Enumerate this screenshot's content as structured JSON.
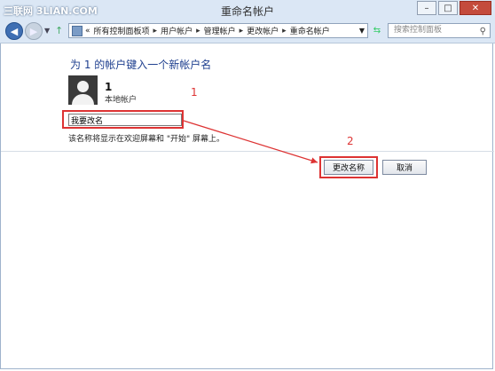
{
  "watermark": "三联网 3LIAN.COM",
  "window": {
    "title": "重命名帐户"
  },
  "addressbar": {
    "prefix": "«",
    "crumbs": [
      "所有控制面板项",
      "用户帐户",
      "管理帐户",
      "更改帐户",
      "重命名帐户"
    ],
    "separator": "▸"
  },
  "search": {
    "placeholder": "搜索控制面板"
  },
  "main": {
    "heading": "为 1 的帐户键入一个新帐户名",
    "user": {
      "name": "1",
      "type": "本地帐户"
    },
    "new_name_value": "我要改名",
    "note": "该名称将显示在欢迎屏幕和 \"开始\" 屏幕上。",
    "rename_button": "更改名称",
    "cancel_button": "取消"
  },
  "annotations": {
    "step1": "1",
    "step2": "2",
    "color": "#dd3333"
  }
}
